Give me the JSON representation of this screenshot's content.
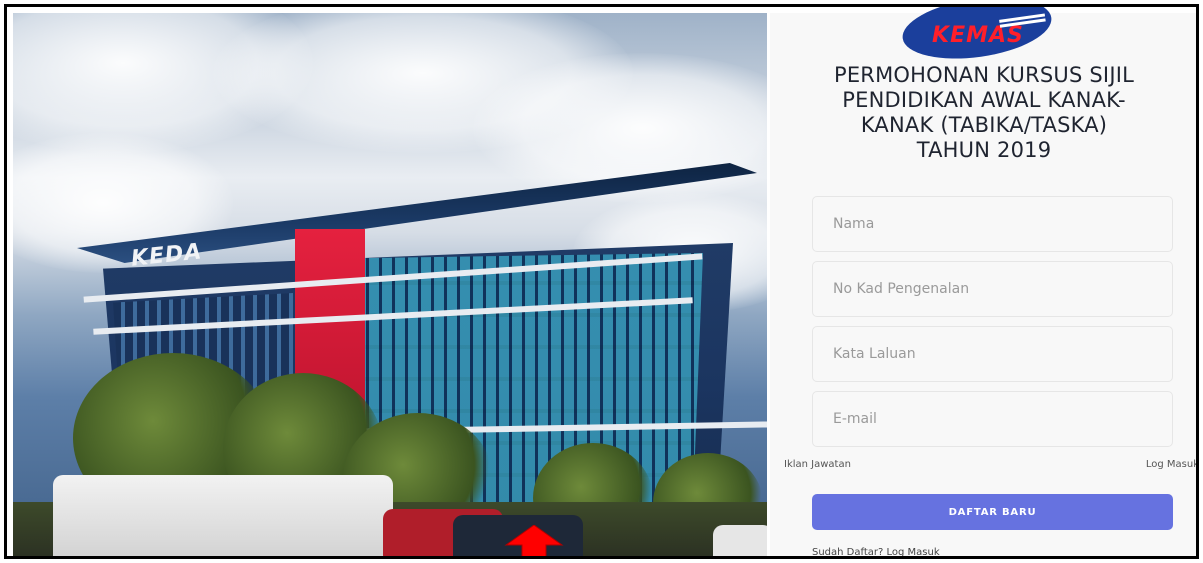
{
  "hero": {
    "building_sign": "KEDA",
    "building_sign_lower": "KEDA"
  },
  "brand": {
    "logo_text": "KEMAS"
  },
  "form": {
    "title_lines": [
      "PERMOHONAN KURSUS SIJIL",
      "PENDIDIKAN AWAL KANAK-",
      "KANAK (TABIKA/TASKA)",
      "TAHUN 2019"
    ],
    "name_placeholder": "Nama",
    "ic_placeholder": "No Kad Pengenalan",
    "password_placeholder": "Kata Laluan",
    "email_placeholder": "E-mail",
    "link_left": "Iklan Jawatan",
    "link_right": "Log Masuk",
    "submit_label": "DAFTAR BARU",
    "footer_text": "Sudah Daftar? Log Masuk"
  },
  "colors": {
    "accent_button": "#6672e0",
    "annotation_arrow": "#ff0000",
    "logo_blue": "#1b3f9c",
    "logo_red": "#ff1f2a"
  }
}
